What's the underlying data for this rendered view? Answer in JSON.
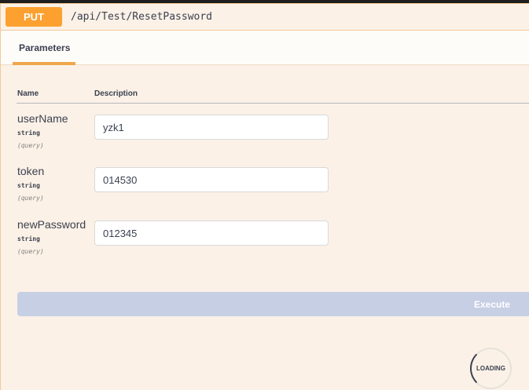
{
  "operation": {
    "method": "PUT",
    "path": "/api/Test/ResetPassword"
  },
  "tabs": {
    "parameters_label": "Parameters"
  },
  "table": {
    "name_header": "Name",
    "description_header": "Description"
  },
  "parameters": [
    {
      "name": "userName",
      "type": "string",
      "in": "(query)",
      "value": "yzk1"
    },
    {
      "name": "token",
      "type": "string",
      "in": "(query)",
      "value": "014530"
    },
    {
      "name": "newPassword",
      "type": "string",
      "in": "(query)",
      "value": "012345"
    }
  ],
  "execute": {
    "label": "Execute"
  },
  "loading": {
    "label": "LOADING"
  },
  "colors": {
    "method_put": "#fca130",
    "accent_border": "#f3c999",
    "panel_bg": "#fbf1e6",
    "execute_disabled": "#c6cfe4"
  }
}
